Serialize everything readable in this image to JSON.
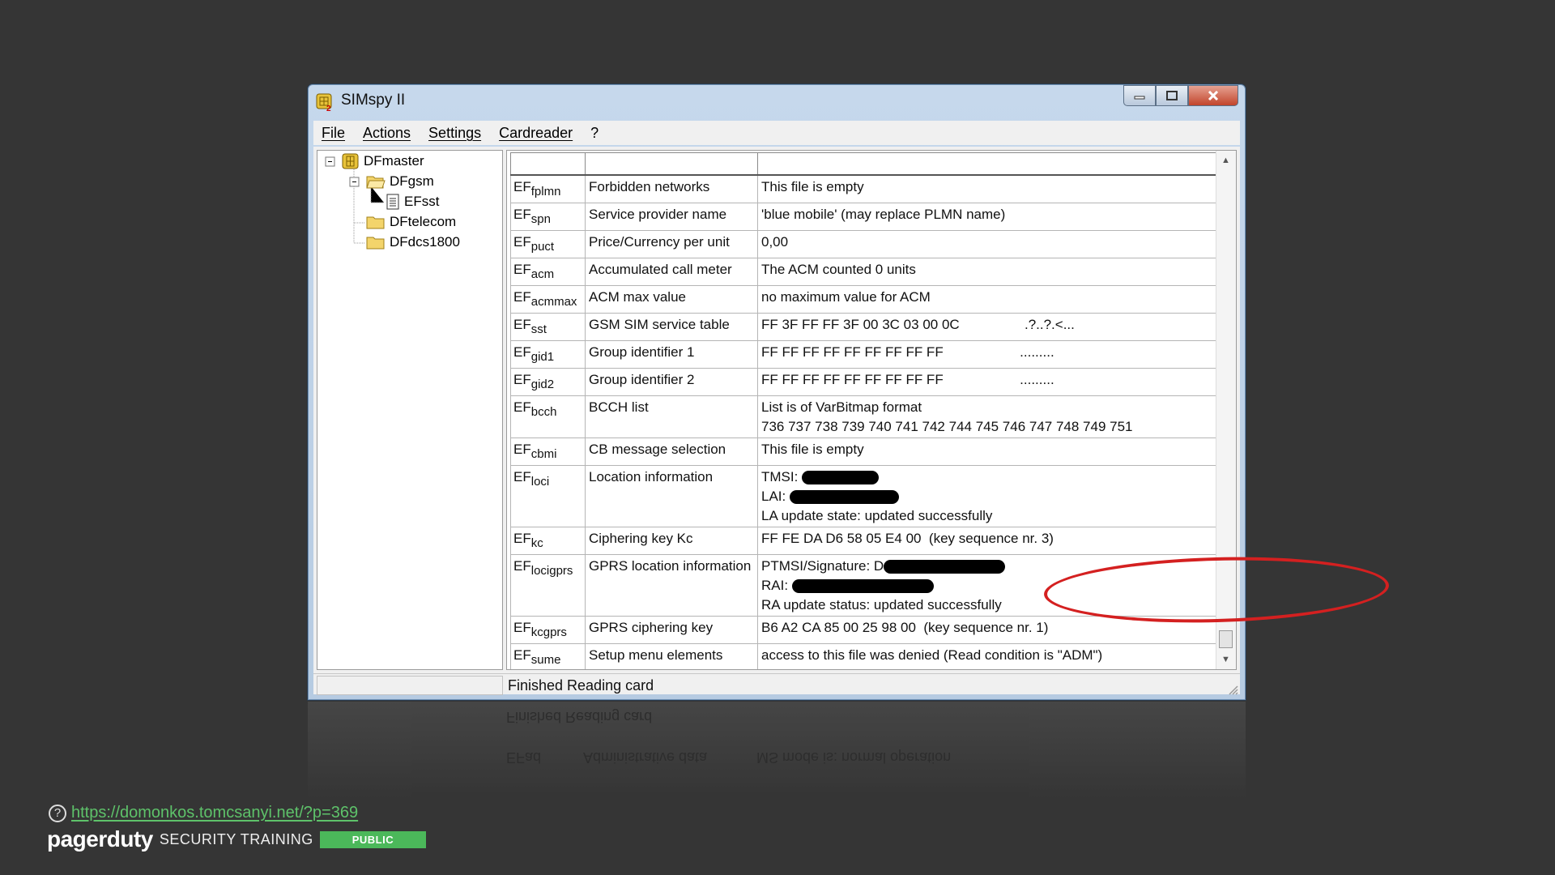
{
  "window": {
    "title": "SIMspy II",
    "menu": [
      "File",
      "Actions",
      "Settings",
      "Cardreader",
      "?"
    ]
  },
  "tree": [
    {
      "label": "DFmaster",
      "icon": "chip-icon"
    },
    {
      "label": "DFgsm",
      "icon": "folder-open-icon"
    },
    {
      "label": "EFsst",
      "icon": "document-icon"
    },
    {
      "label": "DFtelecom",
      "icon": "folder-icon"
    },
    {
      "label": "DFdcs1800",
      "icon": "folder-icon"
    }
  ],
  "table": {
    "rows": [
      {
        "ef": "EF",
        "sub": "fplmn",
        "name": "Forbidden networks",
        "lines": [
          "This file is empty"
        ]
      },
      {
        "ef": "EF",
        "sub": "spn",
        "name": "Service provider name",
        "lines": [
          "'blue mobile' (may replace PLMN name)"
        ]
      },
      {
        "ef": "EF",
        "sub": "puct",
        "name": "Price/Currency per unit",
        "lines": [
          "0,00"
        ]
      },
      {
        "ef": "EF",
        "sub": "acm",
        "name": "Accumulated call meter",
        "lines": [
          "The ACM counted 0 units"
        ]
      },
      {
        "ef": "EF",
        "sub": "acmmax",
        "name": "ACM max value",
        "lines": [
          "no maximum value for ACM"
        ]
      },
      {
        "ef": "EF",
        "sub": "sst",
        "name": "GSM SIM service table",
        "lines": [
          "FF 3F FF FF 3F 00 3C 03 00 0C                 .?..?.<..."
        ]
      },
      {
        "ef": "EF",
        "sub": "gid1",
        "name": "Group identifier 1",
        "lines": [
          "FF FF FF FF FF FF FF FF FF                    ........."
        ]
      },
      {
        "ef": "EF",
        "sub": "gid2",
        "name": "Group identifier 2",
        "lines": [
          "FF FF FF FF FF FF FF FF FF                    ........."
        ]
      },
      {
        "ef": "EF",
        "sub": "bcch",
        "name": "BCCH list",
        "lines": [
          "List is of VarBitmap format",
          "736 737 738 739 740 741 742 744 745 746 747 748 749 751"
        ]
      },
      {
        "ef": "EF",
        "sub": "cbmi",
        "name": "CB message selection",
        "lines": [
          "This file is empty"
        ]
      },
      {
        "ef": "EF",
        "sub": "loci",
        "name": "Location information",
        "lines": [
          "TMSI: ",
          "LAI: ",
          "LA update state: updated successfully"
        ]
      },
      {
        "ef": "EF",
        "sub": "kc",
        "name": "Ciphering key Kc",
        "lines": [
          "FF FE DA D6 58 05 E4 00  (key sequence nr. 3)"
        ]
      },
      {
        "ef": "EF",
        "sub": "locigprs",
        "name": "GPRS location information",
        "lines": [
          "PTMSI/Signature: D",
          "RAI: ",
          "RA update status: updated successfully"
        ]
      },
      {
        "ef": "EF",
        "sub": "kcgprs",
        "name": "GPRS ciphering key",
        "lines": [
          "B6 A2 CA 85 00 25 98 00  (key sequence nr. 1)"
        ]
      },
      {
        "ef": "EF",
        "sub": "sume",
        "name": "Setup menu elements",
        "lines": [
          "access to this file was denied (Read condition is \"ADM\")"
        ]
      },
      {
        "ef": "EF",
        "sub": "ad",
        "name": "Administrative data",
        "lines": [
          "MS mode is: normal operation"
        ]
      }
    ]
  },
  "status": "Finished Reading card",
  "footer": {
    "link": "https://domonkos.tomcsanyi.net/?p=369",
    "logo": "pagerduty",
    "training": "SECURITY TRAINING",
    "badge": "PUBLIC"
  },
  "colors": {
    "accent_green": "#4bb85a",
    "highlight_red": "#d42020"
  }
}
